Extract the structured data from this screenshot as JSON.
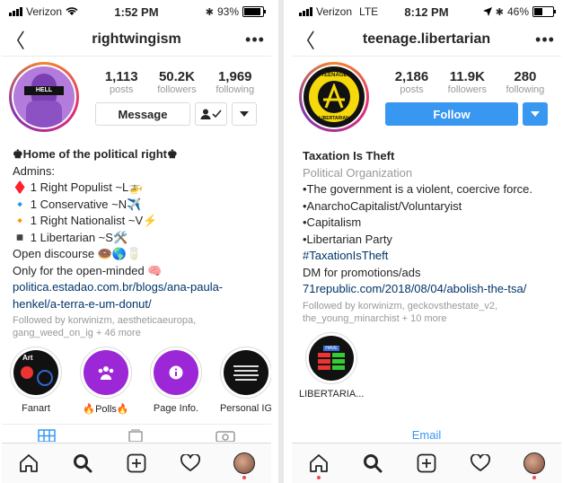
{
  "phones": [
    {
      "status": {
        "carrier": "Verizon",
        "network": "",
        "time": "1:52 PM",
        "battery": "93%",
        "battery_level": 0.93
      },
      "nav": {
        "title": "rightwingism",
        "more": "•••"
      },
      "stats": {
        "posts_count": "1,113",
        "posts_label": "posts",
        "followers_count": "50.2K",
        "followers_label": "followers",
        "following_count": "1,969",
        "following_label": "following"
      },
      "action_button": "Message",
      "avatar_text": "HELL",
      "bio": {
        "name": "♚Home of the political right♚",
        "lines": [
          "Admins:",
          "♦️ 1 Right Populist ~L🚁",
          "🔹 1 Conservative ~N✈️",
          "🔸 1 Right Nationalist ~V⚡",
          "◾ 1 Libertarian ~S🛠️",
          "Open discourse 🍩🌎🥛",
          "Only for the open-minded 🧠"
        ],
        "link_1": "politica.estadao.com.br/blogs/ana-paula-",
        "link_2": "henkel/a-terra-e-um-donut/",
        "followed_1": "Followed by korwinizm, aestheticaeuropa,",
        "followed_2": "gang_weed_on_ig + 46 more"
      },
      "highlights": [
        {
          "label": "Fanart",
          "icon": "fanart-thumbnail",
          "thumb_text": "Art"
        },
        {
          "label": "🔥Polls🔥",
          "icon": "people-icon"
        },
        {
          "label": "Page Info.",
          "icon": "info-icon"
        },
        {
          "label": "Personal IG",
          "icon": "list-thumbnail"
        }
      ]
    },
    {
      "status": {
        "carrier": "Verizon",
        "network": "LTE",
        "time": "8:12 PM",
        "battery": "46%",
        "battery_level": 0.46
      },
      "nav": {
        "title": "teenage.libertarian",
        "more": "•••"
      },
      "stats": {
        "posts_count": "2,186",
        "posts_label": "posts",
        "followers_count": "11.9K",
        "followers_label": "followers",
        "following_count": "280",
        "following_label": "following"
      },
      "action_button": "Follow",
      "avatar_text_top": "TEENAGE",
      "avatar_text_bottom": "LIBERTARIAN",
      "bio": {
        "name": "Taxation Is Theft",
        "category": "Political Organization",
        "lines": [
          "•The government is a violent, coercive force.",
          "•AnarchoCapitalist/Voluntaryist",
          "•Capitalism",
          "•Libertarian Party"
        ],
        "hashtag": "#TaxationIsTheft",
        "dm_line": "DM for promotions/ads",
        "link_1": "71republic.com/2018/08/04/abolish-the-tsa/",
        "followed_1": "Followed by korwinizm, geckovsthestate_v2,",
        "followed_2": "the_young_minarchist + 10 more"
      },
      "highlights": [
        {
          "label": "LIBERTARIA...",
          "icon": "chart-thumbnail",
          "thumb_text": "HAVE"
        }
      ],
      "email": "Email"
    }
  ],
  "bottom_nav": [
    "home-icon",
    "search-icon",
    "new-post-icon",
    "activity-heart-icon",
    "profile-avatar-icon"
  ],
  "colors": {
    "accent": "#3897f0",
    "text": "#262626",
    "muted": "#999999",
    "link": "#003569",
    "highlight_purple": "#9c27d6"
  }
}
